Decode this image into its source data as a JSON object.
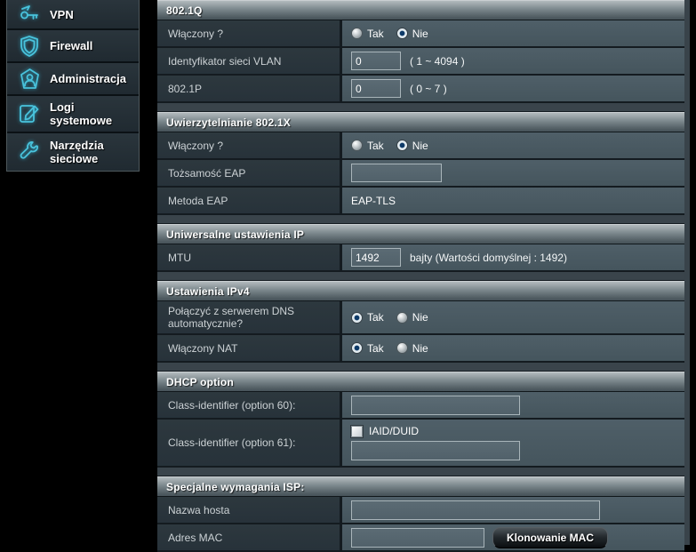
{
  "colors": {
    "accent": "#49c3dc",
    "header_text": "#fdfefe",
    "section_gradient_top": "#b2babd",
    "section_gradient_bottom": "#47535a",
    "label_cell": "#2a353b",
    "value_cell": "#4a5a62",
    "radio_selected_dot": "#0d3a68"
  },
  "sidebar": {
    "items": [
      {
        "label": "VPN"
      },
      {
        "label": "Firewall"
      },
      {
        "label": "Administracja"
      },
      {
        "label": "Logi systemowe"
      },
      {
        "label": "Narzędzia sieciowe"
      }
    ]
  },
  "radio": {
    "yes": "Tak",
    "no": "Nie"
  },
  "sections": [
    {
      "title": "802.1Q",
      "rows": [
        {
          "label": "Włączony ?",
          "selected": "Nie"
        },
        {
          "label": "Identyfikator sieci VLAN",
          "value": "0",
          "hint": "( 1 ~ 4094 )"
        },
        {
          "label": "802.1P",
          "value": "0",
          "hint": "( 0 ~ 7 )"
        }
      ]
    },
    {
      "title": "Uwierzytelnianie 802.1X",
      "rows": [
        {
          "label": "Włączony ?",
          "selected": "Nie"
        },
        {
          "label": "Tożsamość EAP",
          "value": ""
        },
        {
          "label": "Metoda EAP",
          "text": "EAP-TLS"
        }
      ]
    },
    {
      "title": "Uniwersalne ustawienia IP",
      "rows": [
        {
          "label": "MTU",
          "value": "1492",
          "hint": "bajty (Wartości domyślnej : 1492)"
        }
      ]
    },
    {
      "title": "Ustawienia IPv4",
      "rows": [
        {
          "label": "Połączyć z serwerem DNS automatycznie?",
          "selected": "Tak"
        },
        {
          "label": "Włączony NAT",
          "selected": "Tak"
        }
      ]
    },
    {
      "title": "DHCP option",
      "rows": [
        {
          "label": "Class-identifier (option 60):",
          "value": ""
        },
        {
          "label": "Class-identifier (option 61):",
          "checkbox_label": "IAID/DUID",
          "checkbox_checked": false,
          "value": ""
        }
      ]
    },
    {
      "title": "Specjalne wymagania ISP:",
      "rows": [
        {
          "label": "Nazwa hosta",
          "value": ""
        },
        {
          "label": "Adres MAC",
          "value": "",
          "button": "Klonowanie MAC"
        }
      ]
    }
  ]
}
